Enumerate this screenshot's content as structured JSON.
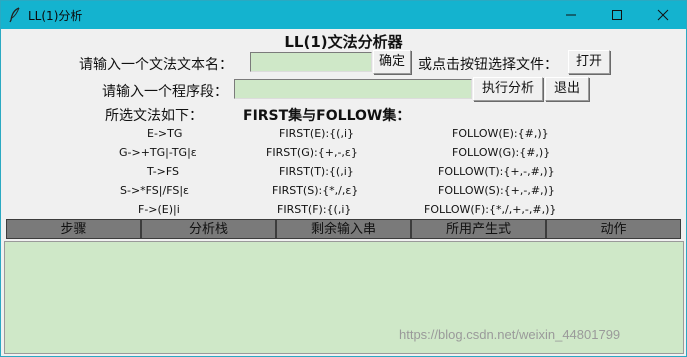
{
  "window": {
    "title": "LL(1)分析",
    "icons": {
      "app": "feather-icon",
      "minimize": "minimize-icon",
      "maximize": "maximize-icon",
      "close": "close-icon"
    }
  },
  "heading": "LL(1)文法分析器",
  "file_row": {
    "label": "请输入一个文法文本名：",
    "input_value": "",
    "confirm_button": "确定",
    "or_label": "或点击按钮选择文件：",
    "open_button": "打开"
  },
  "program_row": {
    "label": "请输入一个程序段：",
    "input_value": "",
    "run_button": "执行分析",
    "exit_button": "退出"
  },
  "grammar_section": {
    "title": "所选文法如下：",
    "sets_title": "FIRST集与FOLLOW集：",
    "rows": [
      {
        "production": "E->TG",
        "first": "FIRST(E):{(,i}",
        "follow": "FOLLOW(E):{#,)}"
      },
      {
        "production": "G->+TG|-TG|ε",
        "first": "FIRST(G):{+,-,ε}",
        "follow": "FOLLOW(G):{#,)}"
      },
      {
        "production": "T->FS",
        "first": "FIRST(T):{(,i}",
        "follow": "FOLLOW(T):{+,-,#,)}"
      },
      {
        "production": "S->*FS|/FS|ε",
        "first": "FIRST(S):{*,/,ε}",
        "follow": "FOLLOW(S):{+,-,#,)}"
      },
      {
        "production": "F->(E)|i",
        "first": "FIRST(F):{(,i}",
        "follow": "FOLLOW(F):{*,/,+,-,#,)}"
      }
    ]
  },
  "table": {
    "headers": [
      "步骤",
      "分析栈",
      "剩余输入串",
      "所用产生式",
      "动作"
    ]
  },
  "watermark": "https://blog.csdn.net/weixin_44801799",
  "colors": {
    "titlebar": "#14b3cf",
    "entry_bg": "#cfe8c8",
    "header_bg": "#7a7a7a",
    "window_bg": "#f0f0f0"
  }
}
